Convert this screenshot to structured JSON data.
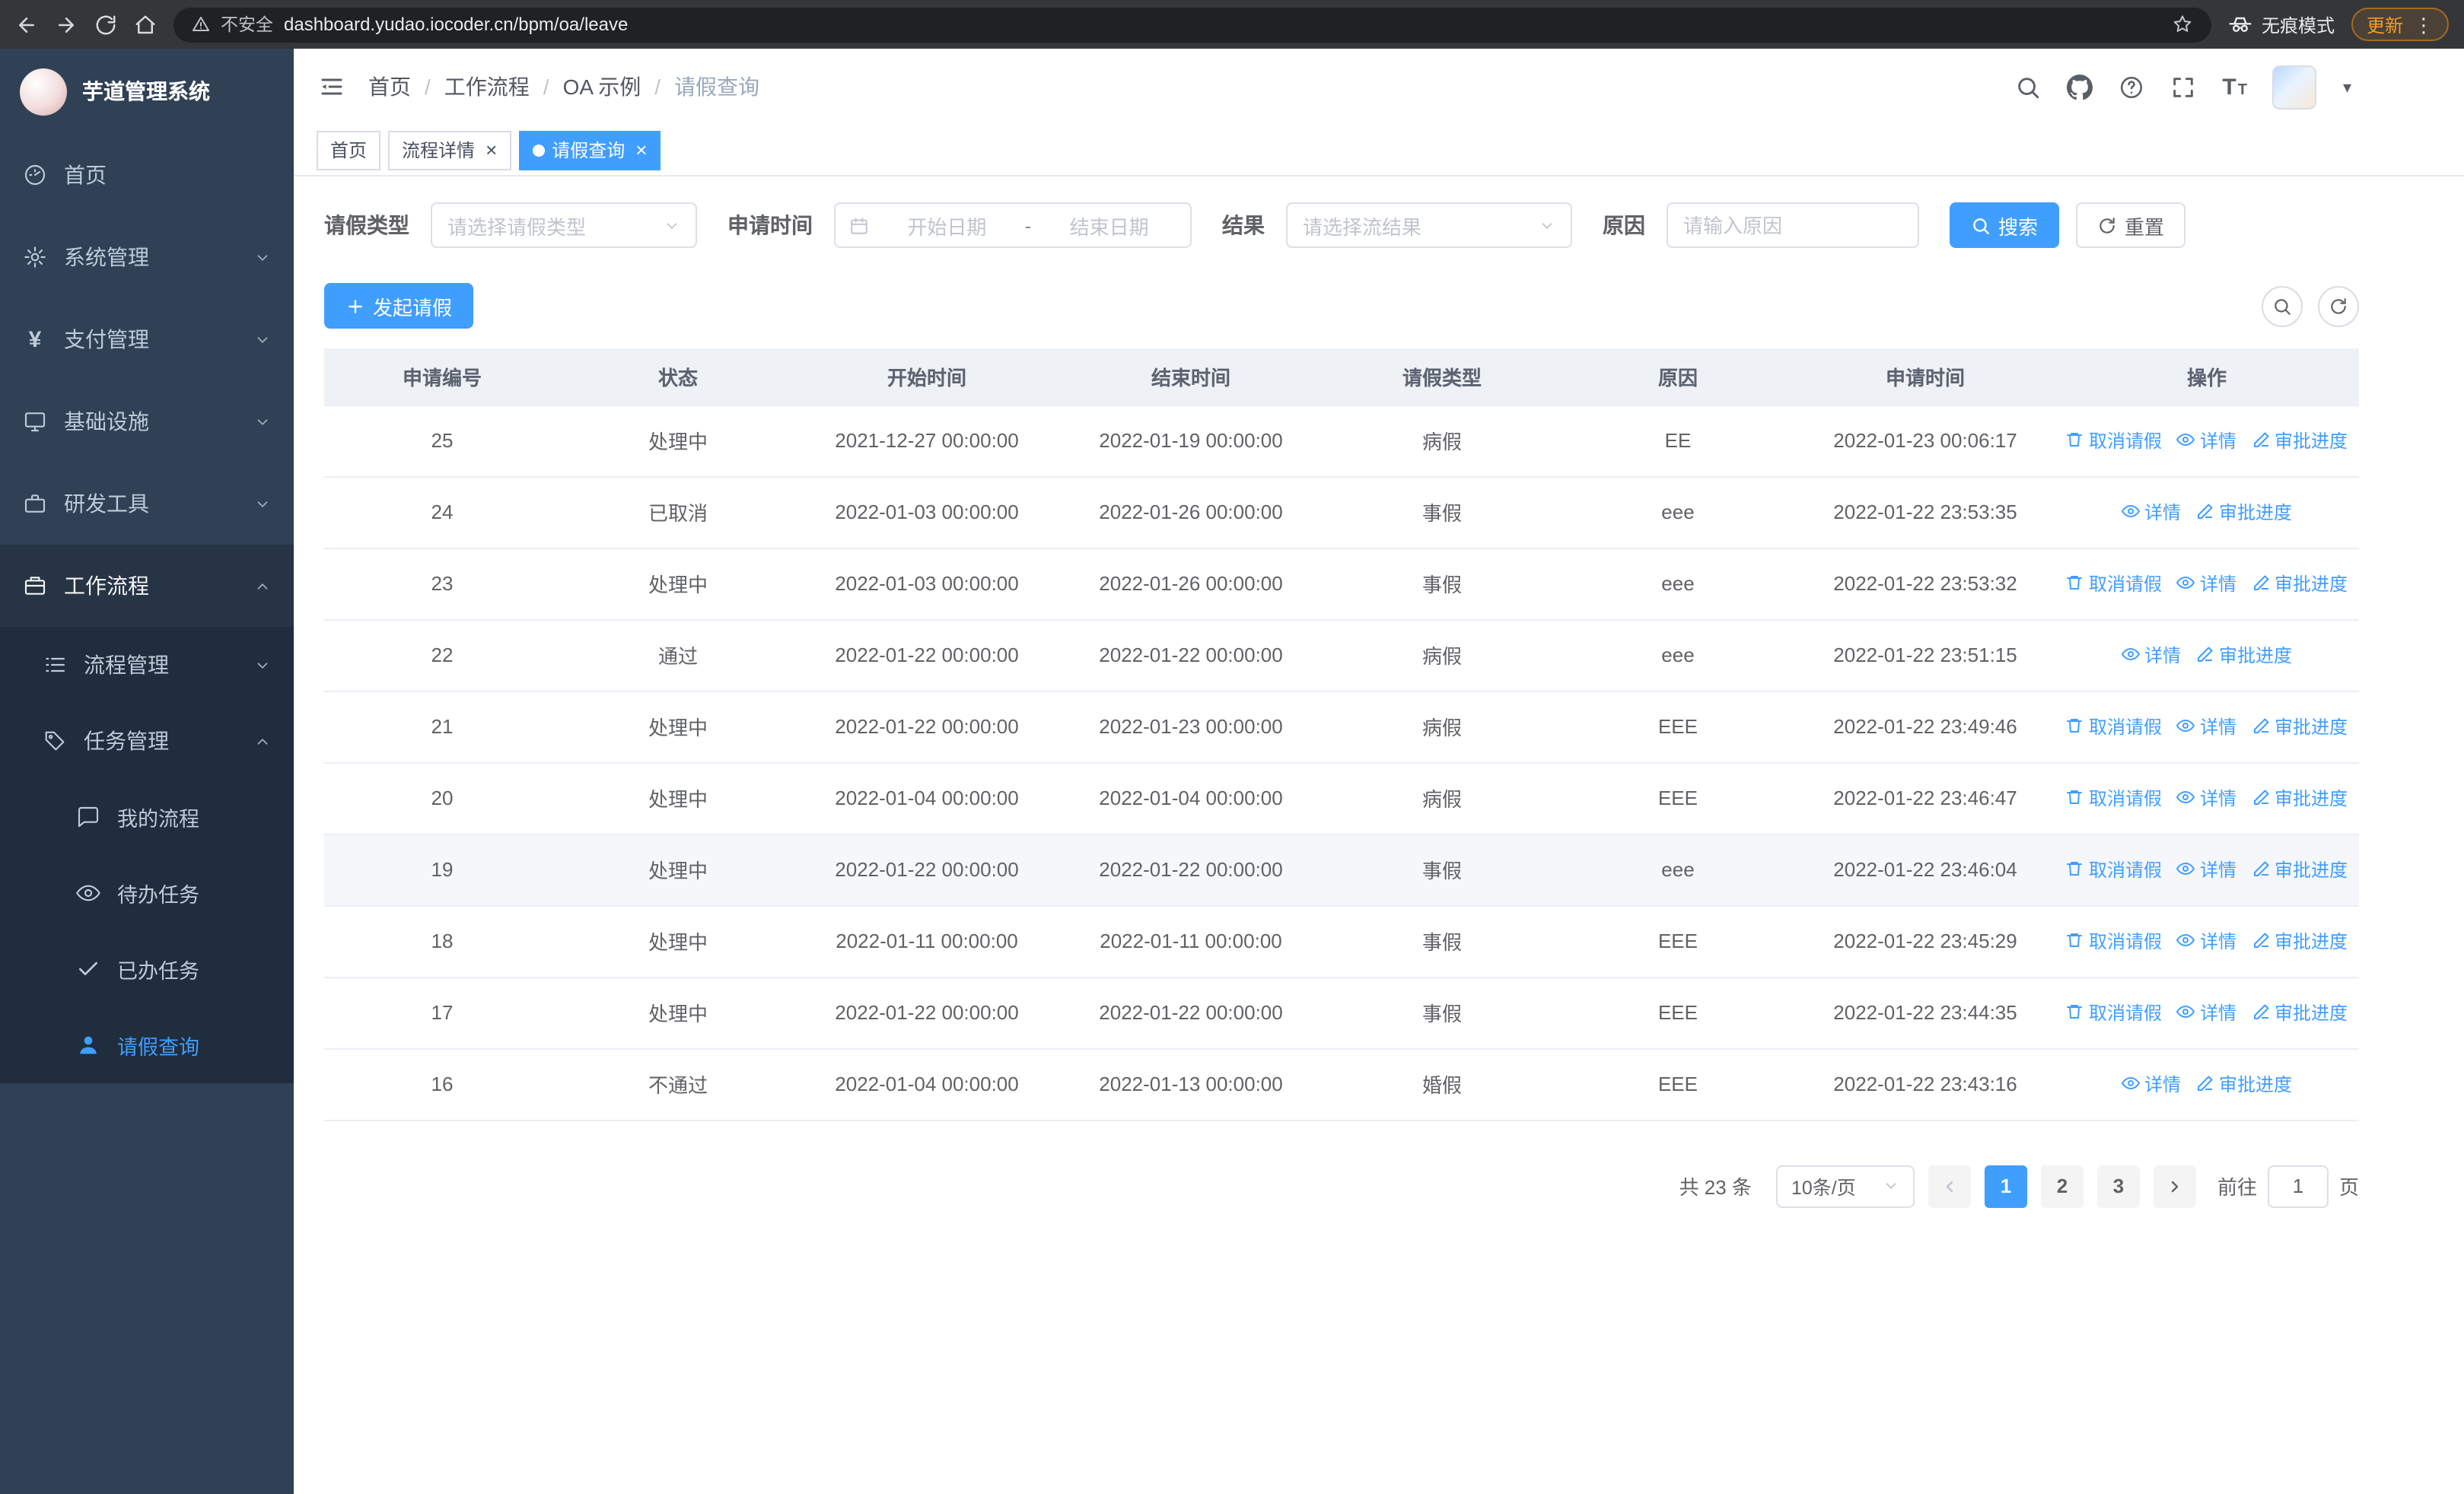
{
  "browser": {
    "security_label": "不安全",
    "url": "dashboard.yudao.iocoder.cn/bpm/oa/leave",
    "incognito_label": "无痕模式",
    "update_label": "更新",
    "menu_glyph": "⋮"
  },
  "ui": {
    "close_glyph": "×",
    "caret_glyph": "▾",
    "yen_glyph": "¥",
    "font_glyph_large": "T",
    "font_glyph_small": "T",
    "separator": "/"
  },
  "sidebar": {
    "title": "芋道管理系统",
    "menu": [
      {
        "label": "首页"
      },
      {
        "label": "系统管理"
      },
      {
        "label": "支付管理"
      },
      {
        "label": "基础设施"
      },
      {
        "label": "研发工具"
      },
      {
        "label": "工作流程"
      }
    ],
    "workflow_children": [
      {
        "label": "流程管理"
      },
      {
        "label": "任务管理"
      }
    ],
    "task_children": [
      {
        "label": "我的流程"
      },
      {
        "label": "待办任务"
      },
      {
        "label": "已办任务"
      },
      {
        "label": "请假查询"
      }
    ]
  },
  "navbar": {
    "breadcrumb": [
      "首页",
      "工作流程",
      "OA 示例",
      "请假查询"
    ]
  },
  "tags": [
    {
      "label": "首页"
    },
    {
      "label": "流程详情"
    },
    {
      "label": "请假查询"
    }
  ],
  "filters": {
    "leave_type_label": "请假类型",
    "leave_type_placeholder": "请选择请假类型",
    "apply_time_label": "申请时间",
    "start_date_placeholder": "开始日期",
    "range_separator": "-",
    "end_date_placeholder": "结束日期",
    "result_label": "结果",
    "result_placeholder": "请选择流结果",
    "reason_label": "原因",
    "reason_placeholder": "请输入原因",
    "search_label": "搜索",
    "reset_label": "重置"
  },
  "toolbar": {
    "create_label": "发起请假"
  },
  "table": {
    "columns": [
      "申请编号",
      "状态",
      "开始时间",
      "结束时间",
      "请假类型",
      "原因",
      "申请时间",
      "操作"
    ],
    "action_labels": {
      "cancel": "取消请假",
      "detail": "详情",
      "progress": "审批进度"
    },
    "action_icons": {
      "cancel": "trash-icon",
      "detail": "eye-icon",
      "progress": "pen-icon"
    },
    "action_names": {
      "cancel": "cancel-leave-link",
      "detail": "detail-link",
      "progress": "approval-progress-link"
    },
    "rows": [
      {
        "id": "25",
        "status": "处理中",
        "start": "2021-12-27 00:00:00",
        "end": "2022-01-19 00:00:00",
        "type": "病假",
        "reason": "EE",
        "apply_time": "2022-01-23 00:06:17",
        "actions": [
          "cancel",
          "detail",
          "progress"
        ],
        "hover": false
      },
      {
        "id": "24",
        "status": "已取消",
        "start": "2022-01-03 00:00:00",
        "end": "2022-01-26 00:00:00",
        "type": "事假",
        "reason": "eee",
        "apply_time": "2022-01-22 23:53:35",
        "actions": [
          "detail",
          "progress"
        ],
        "hover": false
      },
      {
        "id": "23",
        "status": "处理中",
        "start": "2022-01-03 00:00:00",
        "end": "2022-01-26 00:00:00",
        "type": "事假",
        "reason": "eee",
        "apply_time": "2022-01-22 23:53:32",
        "actions": [
          "cancel",
          "detail",
          "progress"
        ],
        "hover": false
      },
      {
        "id": "22",
        "status": "通过",
        "start": "2022-01-22 00:00:00",
        "end": "2022-01-22 00:00:00",
        "type": "病假",
        "reason": "eee",
        "apply_time": "2022-01-22 23:51:15",
        "actions": [
          "detail",
          "progress"
        ],
        "hover": false
      },
      {
        "id": "21",
        "status": "处理中",
        "start": "2022-01-22 00:00:00",
        "end": "2022-01-23 00:00:00",
        "type": "病假",
        "reason": "EEE",
        "apply_time": "2022-01-22 23:49:46",
        "actions": [
          "cancel",
          "detail",
          "progress"
        ],
        "hover": false
      },
      {
        "id": "20",
        "status": "处理中",
        "start": "2022-01-04 00:00:00",
        "end": "2022-01-04 00:00:00",
        "type": "病假",
        "reason": "EEE",
        "apply_time": "2022-01-22 23:46:47",
        "actions": [
          "cancel",
          "detail",
          "progress"
        ],
        "hover": false
      },
      {
        "id": "19",
        "status": "处理中",
        "start": "2022-01-22 00:00:00",
        "end": "2022-01-22 00:00:00",
        "type": "事假",
        "reason": "eee",
        "apply_time": "2022-01-22 23:46:04",
        "actions": [
          "cancel",
          "detail",
          "progress"
        ],
        "hover": true
      },
      {
        "id": "18",
        "status": "处理中",
        "start": "2022-01-11 00:00:00",
        "end": "2022-01-11 00:00:00",
        "type": "事假",
        "reason": "EEE",
        "apply_time": "2022-01-22 23:45:29",
        "actions": [
          "cancel",
          "detail",
          "progress"
        ],
        "hover": false
      },
      {
        "id": "17",
        "status": "处理中",
        "start": "2022-01-22 00:00:00",
        "end": "2022-01-22 00:00:00",
        "type": "事假",
        "reason": "EEE",
        "apply_time": "2022-01-22 23:44:35",
        "actions": [
          "cancel",
          "detail",
          "progress"
        ],
        "hover": false
      },
      {
        "id": "16",
        "status": "不通过",
        "start": "2022-01-04 00:00:00",
        "end": "2022-01-13 00:00:00",
        "type": "婚假",
        "reason": "EEE",
        "apply_time": "2022-01-22 23:43:16",
        "actions": [
          "detail",
          "progress"
        ],
        "hover": false
      }
    ]
  },
  "pagination": {
    "total_text": "共 23 条",
    "page_size_label": "10条/页",
    "pages": [
      "1",
      "2",
      "3"
    ],
    "active_page": "1",
    "goto_label": "前往",
    "goto_value": "1",
    "goto_unit": "页"
  }
}
